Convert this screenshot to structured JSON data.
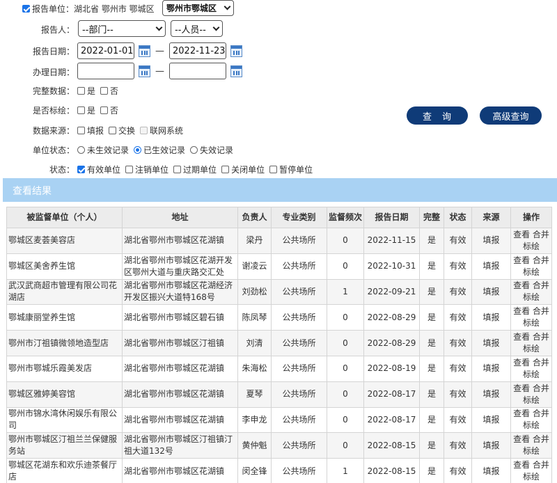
{
  "form": {
    "unit_label": "报告单位：",
    "unit_value": "湖北省 鄂州市 鄂城区",
    "unit_select": "鄂州市鄂城区",
    "reporter_label": "报告人：",
    "dept_select": "--部门--",
    "person_select": "--人员--",
    "report_date_label": "报告日期：",
    "report_date_from": "2022-01-01",
    "report_date_to": "2022-11-23",
    "handle_date_label": "办理日期：",
    "handle_date_from": "",
    "handle_date_to": "",
    "dash": "—",
    "complete_label": "完整数据：",
    "marked_label": "是否标绘：",
    "yes": "是",
    "no": "否",
    "source_label": "数据来源：",
    "source_options": [
      "填报",
      "交换",
      "联网系统"
    ],
    "unit_status_label": "单位状态：",
    "unit_status_options": [
      "未生效记录",
      "已生效记录",
      "失效记录"
    ],
    "status_label": "状态：",
    "status_options": [
      "有效单位",
      "注销单位",
      "过期单位",
      "关闭单位",
      "暂停单位"
    ],
    "query_button": "查　询",
    "advanced_button": "高级查询"
  },
  "results": {
    "title": "查看结果",
    "headers": [
      "被监督单位（个人）",
      "地址",
      "负责人",
      "专业类别",
      "监督频次",
      "报告日期",
      "完整",
      "状态",
      "来源",
      "操作"
    ],
    "ops": {
      "view": "查看",
      "merge": "合并",
      "mark": "标绘"
    },
    "rows": [
      [
        "鄂城区麦荟美容店",
        "湖北省鄂州市鄂城区花湖镇",
        "梁丹",
        "公共场所",
        "0",
        "2022-11-15",
        "是",
        "有效",
        "填报"
      ],
      [
        "鄂城区美舍养生馆",
        "湖北省鄂州市鄂城区花湖开发区鄂州大道与重庆路交汇处",
        "谢凌云",
        "公共场所",
        "0",
        "2022-10-31",
        "是",
        "有效",
        "填报"
      ],
      [
        "武汉武商超市管理有限公司花湖店",
        "湖北省鄂州市鄂城区花湖经济开发区振兴大道特168号",
        "刘劲松",
        "公共场所",
        "1",
        "2022-09-21",
        "是",
        "有效",
        "填报"
      ],
      [
        "鄂城康丽堂养生馆",
        "湖北省鄂州市鄂城区碧石镇",
        "陈凤琴",
        "公共场所",
        "0",
        "2022-08-29",
        "是",
        "有效",
        "填报"
      ],
      [
        "鄂州市汀祖镇微领地造型店",
        "湖北省鄂州市鄂城区汀祖镇",
        "刘清",
        "公共场所",
        "0",
        "2022-08-29",
        "是",
        "有效",
        "填报"
      ],
      [
        "鄂州市鄂城乐霞美发店",
        "湖北省鄂州市鄂城区花湖镇",
        "朱海松",
        "公共场所",
        "0",
        "2022-08-19",
        "是",
        "有效",
        "填报"
      ],
      [
        "鄂城区雅婷美容馆",
        "湖北省鄂州市鄂城区花湖镇",
        "夏琴",
        "公共场所",
        "0",
        "2022-08-17",
        "是",
        "有效",
        "填报"
      ],
      [
        "鄂州市锦水湾休闲娱乐有限公司",
        "湖北省鄂州市鄂城区花湖镇",
        "李申龙",
        "公共场所",
        "0",
        "2022-08-17",
        "是",
        "有效",
        "填报"
      ],
      [
        "鄂州市鄂城区汀祖兰兰保健服务站",
        "湖北省鄂州市鄂城区汀祖镇汀祖大道132号",
        "黄仲魁",
        "公共场所",
        "0",
        "2022-08-15",
        "是",
        "有效",
        "填报"
      ],
      [
        "鄂城区花湖东和欢乐迪茶餐厅店",
        "湖北省鄂州市鄂城区花湖镇",
        "闵全锋",
        "公共场所",
        "1",
        "2022-08-15",
        "是",
        "有效",
        "填报"
      ]
    ]
  }
}
